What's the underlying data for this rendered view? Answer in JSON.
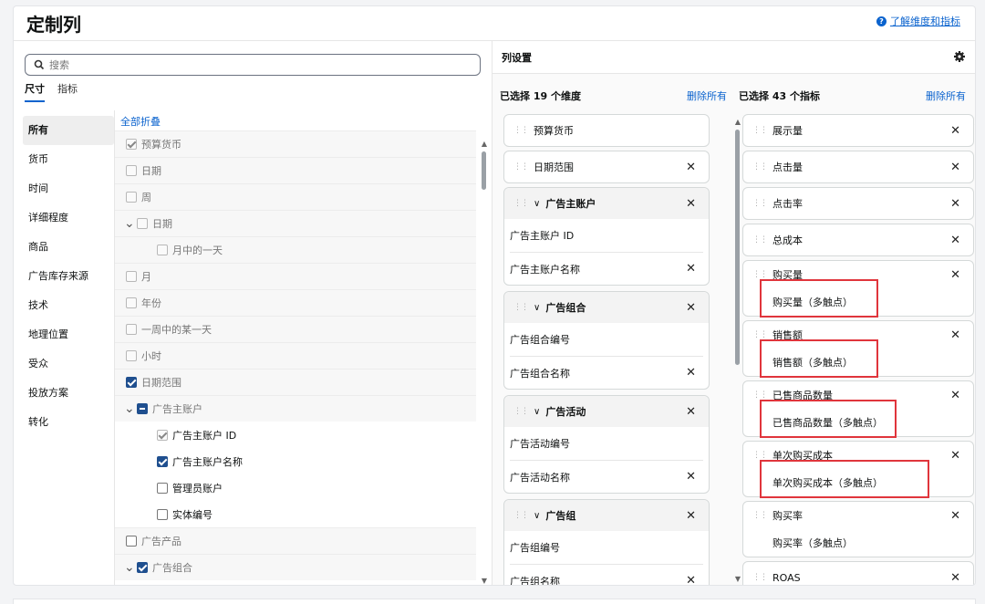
{
  "header": {
    "title": "定制列",
    "help_link": "了解维度和指标"
  },
  "search": {
    "placeholder": "搜索",
    "value": ""
  },
  "tabs": [
    {
      "label": "尺寸",
      "active": true
    },
    {
      "label": "指标",
      "active": false
    }
  ],
  "categories": [
    "所有",
    "货币",
    "时间",
    "详细程度",
    "商品",
    "广告库存来源",
    "技术",
    "地理位置",
    "受众",
    "投放方案",
    "转化"
  ],
  "tree": {
    "collapse_all": "全部折叠",
    "rows": [
      {
        "label": "预算货币",
        "state": "disabled-checked",
        "style": "gray"
      },
      {
        "label": "日期",
        "state": "disabled",
        "style": "gray"
      },
      {
        "label": "周",
        "state": "disabled",
        "style": "gray"
      },
      {
        "label": "日期",
        "state": "disabled",
        "style": "gray",
        "expander": true
      },
      {
        "label": "月中的一天",
        "state": "disabled",
        "style": "gray",
        "indent": true
      },
      {
        "label": "月",
        "state": "disabled",
        "style": "gray"
      },
      {
        "label": "年份",
        "state": "disabled",
        "style": "gray"
      },
      {
        "label": "一周中的某一天",
        "state": "disabled",
        "style": "gray"
      },
      {
        "label": "小时",
        "state": "disabled",
        "style": "gray"
      },
      {
        "label": "日期范围",
        "state": "checked",
        "style": "gray"
      },
      {
        "label": "广告主账户",
        "state": "partial",
        "style": "gray",
        "expander": true
      },
      {
        "label": "广告主账户 ID",
        "state": "disabled-checked",
        "style": "white",
        "indent": true
      },
      {
        "label": "广告主账户名称",
        "state": "checked",
        "style": "white",
        "indent": true
      },
      {
        "label": "管理员账户",
        "state": "unchecked",
        "style": "white",
        "indent": true
      },
      {
        "label": "实体编号",
        "state": "unchecked",
        "style": "white",
        "indent": true
      },
      {
        "label": "广告产品",
        "state": "unchecked",
        "style": "gray"
      },
      {
        "label": "广告组合",
        "state": "checked",
        "style": "gray",
        "expander": true
      }
    ]
  },
  "right": {
    "title": "列设置",
    "dimensions": {
      "heading": "已选择 19 个维度",
      "delete_all": "删除所有",
      "items": [
        {
          "label": "预算货币",
          "removable": false
        },
        {
          "label": "日期范围",
          "removable": true
        },
        {
          "group": "广告主账户",
          "children": [
            {
              "label": "广告主账户 ID",
              "removable": false
            },
            {
              "label": "广告主账户名称",
              "removable": true
            }
          ]
        },
        {
          "group": "广告组合",
          "children": [
            {
              "label": "广告组合编号",
              "removable": false
            },
            {
              "label": "广告组合名称",
              "removable": true
            }
          ]
        },
        {
          "group": "广告活动",
          "children": [
            {
              "label": "广告活动编号",
              "removable": false
            },
            {
              "label": "广告活动名称",
              "removable": true
            }
          ]
        },
        {
          "group": "广告组",
          "children": [
            {
              "label": "广告组编号",
              "removable": false
            },
            {
              "label": "广告组名称",
              "removable": true
            }
          ]
        }
      ]
    },
    "metrics": {
      "heading": "已选择 43 个指标",
      "delete_all": "删除所有",
      "items": [
        {
          "label": "展示量"
        },
        {
          "label": "点击量"
        },
        {
          "label": "点击率"
        },
        {
          "label": "总成本"
        },
        {
          "label": "购买量",
          "sub": "购买量（多触点）",
          "highlight": true
        },
        {
          "label": "销售额",
          "sub": "销售额（多触点）",
          "highlight": true
        },
        {
          "label": "已售商品数量",
          "sub": "已售商品数量（多触点）",
          "highlight": true
        },
        {
          "label": "单次购买成本",
          "sub": "单次购买成本（多触点）",
          "highlight": true
        },
        {
          "label": "购买率",
          "sub": "购买率（多触点）",
          "highlight": false
        },
        {
          "label": "ROAS"
        }
      ]
    }
  },
  "icons": {
    "search": "search-icon",
    "gear": "gear-icon",
    "help": "help-icon",
    "close": "close-icon",
    "grip": "drag-handle-icon",
    "chevron": "chevron-down-icon"
  },
  "colors": {
    "accent": "#0b63ce",
    "checkbox": "#1f4f8f",
    "highlight": "#e0353c"
  }
}
